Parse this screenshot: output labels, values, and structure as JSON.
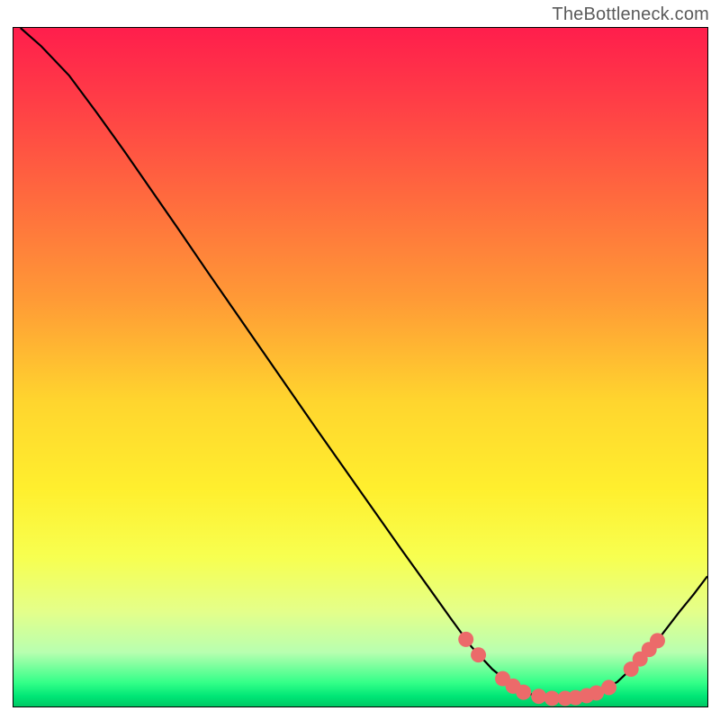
{
  "watermark": "TheBottleneck.com",
  "chart_data": {
    "type": "line",
    "title": "",
    "xlabel": "",
    "ylabel": "",
    "xlim": [
      0,
      100
    ],
    "ylim": [
      0,
      100
    ],
    "gradient_stops": [
      {
        "offset": 0.0,
        "color": "#ff1e4c"
      },
      {
        "offset": 0.1,
        "color": "#ff3b47"
      },
      {
        "offset": 0.25,
        "color": "#ff6a3e"
      },
      {
        "offset": 0.4,
        "color": "#ff9a36"
      },
      {
        "offset": 0.55,
        "color": "#ffd52e"
      },
      {
        "offset": 0.68,
        "color": "#ffef2e"
      },
      {
        "offset": 0.78,
        "color": "#f7ff50"
      },
      {
        "offset": 0.86,
        "color": "#e4ff8a"
      },
      {
        "offset": 0.92,
        "color": "#b8ffb0"
      },
      {
        "offset": 0.965,
        "color": "#33ff88"
      },
      {
        "offset": 0.985,
        "color": "#00e676"
      },
      {
        "offset": 1.0,
        "color": "#00c864"
      }
    ],
    "curve": [
      {
        "x": 1.0,
        "y": 100.0
      },
      {
        "x": 4.0,
        "y": 97.3
      },
      {
        "x": 8.0,
        "y": 93.0
      },
      {
        "x": 12.0,
        "y": 87.5
      },
      {
        "x": 16.0,
        "y": 81.8
      },
      {
        "x": 20.0,
        "y": 75.9
      },
      {
        "x": 24.0,
        "y": 70.0
      },
      {
        "x": 28.0,
        "y": 64.0
      },
      {
        "x": 32.0,
        "y": 58.1
      },
      {
        "x": 36.0,
        "y": 52.2
      },
      {
        "x": 40.0,
        "y": 46.3
      },
      {
        "x": 44.0,
        "y": 40.4
      },
      {
        "x": 48.0,
        "y": 34.6
      },
      {
        "x": 52.0,
        "y": 28.8
      },
      {
        "x": 56.0,
        "y": 23.0
      },
      {
        "x": 60.0,
        "y": 17.3
      },
      {
        "x": 63.0,
        "y": 13.0
      },
      {
        "x": 66.0,
        "y": 8.8
      },
      {
        "x": 69.0,
        "y": 5.5
      },
      {
        "x": 72.0,
        "y": 3.0
      },
      {
        "x": 75.0,
        "y": 1.6
      },
      {
        "x": 78.0,
        "y": 1.2
      },
      {
        "x": 81.0,
        "y": 1.3
      },
      {
        "x": 84.0,
        "y": 2.0
      },
      {
        "x": 87.0,
        "y": 3.6
      },
      {
        "x": 90.0,
        "y": 6.5
      },
      {
        "x": 93.0,
        "y": 10.0
      },
      {
        "x": 96.0,
        "y": 14.0
      },
      {
        "x": 98.0,
        "y": 16.5
      },
      {
        "x": 100.0,
        "y": 19.2
      }
    ],
    "markers": [
      {
        "x": 65.2,
        "y": 9.9
      },
      {
        "x": 67.0,
        "y": 7.6
      },
      {
        "x": 70.5,
        "y": 4.1
      },
      {
        "x": 72.0,
        "y": 3.0
      },
      {
        "x": 73.5,
        "y": 2.1
      },
      {
        "x": 75.7,
        "y": 1.5
      },
      {
        "x": 77.6,
        "y": 1.2
      },
      {
        "x": 79.5,
        "y": 1.2
      },
      {
        "x": 81.0,
        "y": 1.3
      },
      {
        "x": 82.6,
        "y": 1.6
      },
      {
        "x": 84.0,
        "y": 2.0
      },
      {
        "x": 85.8,
        "y": 2.8
      },
      {
        "x": 89.0,
        "y": 5.5
      },
      {
        "x": 90.3,
        "y": 7.0
      },
      {
        "x": 91.6,
        "y": 8.4
      },
      {
        "x": 92.8,
        "y": 9.7
      }
    ],
    "marker_color": "#ec6a6a",
    "curve_color": "#000000"
  }
}
